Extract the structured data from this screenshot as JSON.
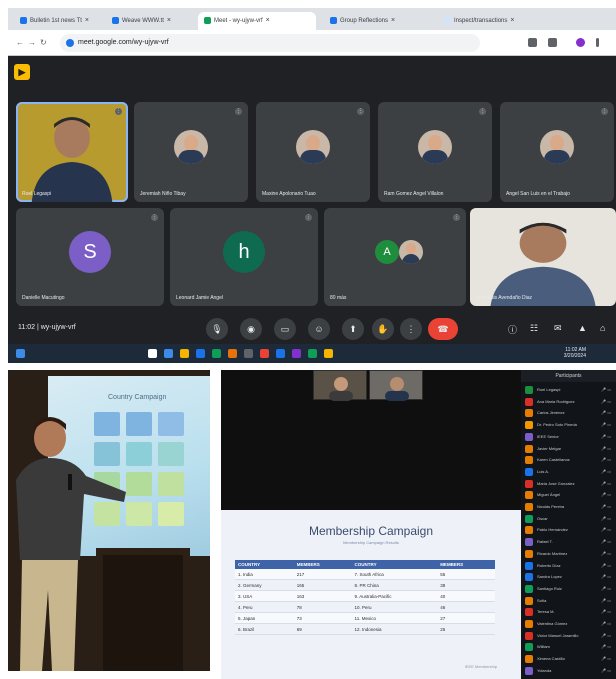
{
  "meet": {
    "tabs": [
      {
        "label": "Bulletin 1st news Tt",
        "color": "#1a73e8",
        "active": false
      },
      {
        "label": "Weave WWW.tt",
        "color": "#1a73e8",
        "active": false
      },
      {
        "label": "Meet - wy-ujyw-vrf",
        "color": "#0f9d58",
        "active": true
      },
      {
        "label": "Group Reflections",
        "color": "#1a73e8",
        "active": false
      },
      {
        "label": "Inspect/transactions",
        "color": "#d2e3fc",
        "active": false
      }
    ],
    "url": "meet.google.com/wy-ujyw-vrf",
    "participants": [
      {
        "name": "Roel Legaspi",
        "kind": "video",
        "speaking": true
      },
      {
        "name": "Jeremiah Niño Tibay",
        "kind": "photo"
      },
      {
        "name": "Maxine Apolonario Tuao",
        "kind": "photo"
      },
      {
        "name": "Ram Gomez Angel Villalon",
        "kind": "photo"
      },
      {
        "name": "Angel San Luis en el Trabajo",
        "kind": "photo"
      },
      {
        "name": "Danielle Macutingo",
        "kind": "letter",
        "letter": "S",
        "color": "#7b5fc7"
      },
      {
        "name": "Leonard Jamie Angel",
        "kind": "letter",
        "letter": "h",
        "color": "#0f6b4f"
      },
      {
        "name": "80 más",
        "kind": "group",
        "letter": "A",
        "color": "#1e8e3e"
      },
      {
        "name": "Jose Luis Avendaño Diaz",
        "kind": "video"
      }
    ],
    "meeting_time": "11:02",
    "meeting_code": "wy-ujyw-vrf",
    "controls": [
      "mic-icon",
      "camera-icon",
      "captions-icon",
      "emoji-icon",
      "present-icon",
      "hand-icon",
      "more-icon",
      "end-call-icon"
    ],
    "tray_time": "11:02 AM",
    "tray_date": "3/20/2024"
  },
  "photo": {
    "screen_title": "Country Campaign"
  },
  "zoom": {
    "panel_title": "Participants",
    "slide_title": "Membership Campaign",
    "slide_subtitle": "Membership Campaign Results",
    "table_headers": [
      "COUNTRY",
      "MEMBERS",
      "COUNTRY",
      "MEMBERS"
    ],
    "table_rows": [
      [
        "1. India",
        "217",
        "7. South Africa",
        "55"
      ],
      [
        "2. Germany",
        "165",
        "8. PR China",
        "38"
      ],
      [
        "3. USA",
        "163",
        "9. Australia-Pacific",
        "40"
      ],
      [
        "4. Peru",
        "78",
        "10. Peru",
        "46"
      ],
      [
        "5. Japan",
        "73",
        "11. Mexico",
        "27"
      ],
      [
        "6. Brazil",
        "69",
        "12. Indonesia",
        "25"
      ]
    ],
    "slide_footer": "IEEE Membership",
    "participants": [
      {
        "name": "Roel Legaspi",
        "color": "#1e8e3e"
      },
      {
        "name": "Ana Maria Rodriguez",
        "color": "#d93025"
      },
      {
        "name": "Carlos Jiménez",
        "color": "#e67c00"
      },
      {
        "name": "Dr. Pedro Soto Pineda",
        "color": "#f29900"
      },
      {
        "name": "IEEE Senior",
        "color": "#7b5fc7"
      },
      {
        "name": "Javier Melgar",
        "color": "#e67c00"
      },
      {
        "name": "Karen Castellanos",
        "color": "#e67c00"
      },
      {
        "name": "Luis A.",
        "color": "#1a73e8"
      },
      {
        "name": "Maria Jose Gonzalez",
        "color": "#d93025"
      },
      {
        "name": "Miguel Ángel",
        "color": "#e67c00"
      },
      {
        "name": "Nicolás Pereira",
        "color": "#e67c00"
      },
      {
        "name": "Oscar",
        "color": "#0f9d58"
      },
      {
        "name": "Pablo Hernández",
        "color": "#e67c00"
      },
      {
        "name": "Rafael T.",
        "color": "#7b5fc7"
      },
      {
        "name": "Ricardo Martinez",
        "color": "#e67c00"
      },
      {
        "name": "Roberto Díaz",
        "color": "#1a73e8"
      },
      {
        "name": "Sandra Lopez",
        "color": "#1a73e8"
      },
      {
        "name": "Santiago Ruiz",
        "color": "#0f9d58"
      },
      {
        "name": "Sofía",
        "color": "#e67c00"
      },
      {
        "name": "Teresa M.",
        "color": "#d93025"
      },
      {
        "name": "Valentina Gómez",
        "color": "#e67c00"
      },
      {
        "name": "Victor Manuel Jaramillo",
        "color": "#d93025"
      },
      {
        "name": "William",
        "color": "#0f9d58"
      },
      {
        "name": "Ximena Castillo",
        "color": "#e67c00"
      },
      {
        "name": "Yolanda",
        "color": "#7b5fc7"
      }
    ]
  }
}
